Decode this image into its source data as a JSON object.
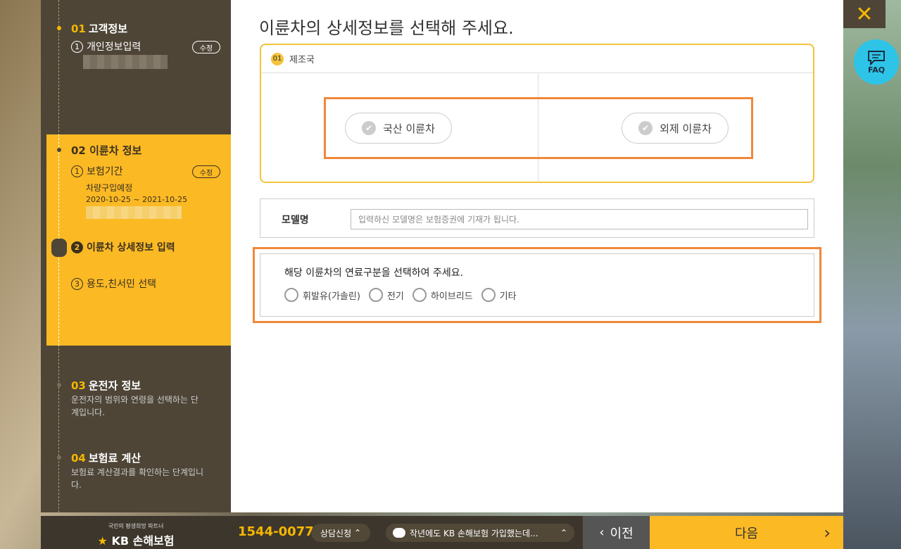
{
  "sidebar": {
    "step1": {
      "num": "01",
      "title": "고객정보",
      "sub_num": "1",
      "sub": "개인정보입력",
      "edit": "수정"
    },
    "step2": {
      "num": "02",
      "title": "이륜차 정보",
      "sub1_num": "1",
      "sub1": "보험기간",
      "edit": "수정",
      "info1": "차량구입예정",
      "info2": "2020-10-25 ~ 2021-10-25",
      "sub2_num": "2",
      "sub2": "이륜차 상세정보 입력",
      "sub3_num": "3",
      "sub3": "용도,친서민 선택"
    },
    "step3": {
      "num": "03",
      "title": "운전자 정보",
      "desc": "운전자의 범위와 연령을 선택하는 단계입니다."
    },
    "step4": {
      "num": "04",
      "title": "보험료 계산",
      "desc": "보험료 계산결과를 확인하는 단계입니다."
    }
  },
  "main": {
    "heading": "이륜차의 상세정보를 선택해 주세요.",
    "section1": {
      "badge": "01",
      "title": "제조국",
      "opt1": "국산 이륜차",
      "opt2": "외제 이륜차"
    },
    "model": {
      "label": "모델명",
      "placeholder": "입력하신 모델명은 보험증권에 기재가 됩니다."
    },
    "fuel": {
      "question": "해당 이륜차의 연료구분을 선택하여 주세요.",
      "options": [
        "휘발유(가솔린)",
        "전기",
        "하이브리드",
        "기타"
      ]
    }
  },
  "faq": "FAQ",
  "footer": {
    "tagline": "국민의 평생희망 파트너",
    "brand": "KB 손해보험",
    "phone": "1544-0077",
    "consult": "상담신청",
    "chat": "작년에도 KB 손해보험 가입했는데...",
    "prev": "이전",
    "next": "다음"
  }
}
